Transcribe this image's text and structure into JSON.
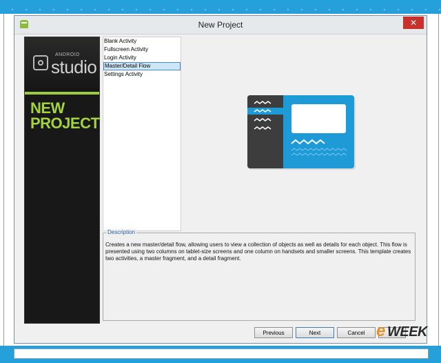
{
  "window": {
    "title": "New Project",
    "close_glyph": "✕"
  },
  "sidebar": {
    "logo_small": "ANDROID",
    "logo_big": "studio",
    "heading_line1": "NEW",
    "heading_line2": "PROJECT"
  },
  "activities": {
    "items": [
      {
        "label": "Blank Activity",
        "selected": false
      },
      {
        "label": "Fullscreen Activity",
        "selected": false
      },
      {
        "label": "Login Activity",
        "selected": false
      },
      {
        "label": "Master/Detail Flow",
        "selected": true
      },
      {
        "label": "Settings Activity",
        "selected": false
      }
    ]
  },
  "description": {
    "legend": "Description",
    "text": "Creates a new master/detail flow, allowing users to view a collection of objects as well as details for each object. This flow is presented using two columns on tablet-size screens and one column on handsets and smaller screens. This template creates two activities, a master fragment, and a detail fragment."
  },
  "buttons": {
    "previous": "Previous",
    "next": "Next",
    "cancel": "Cancel"
  },
  "watermark": {
    "e": "e",
    "week": "WEEK"
  },
  "colors": {
    "taskbar_blue": "#26a0da",
    "sidebar_bg": "#181818",
    "brand_green": "#a4d33d",
    "preview_blue": "#1e9ad6",
    "preview_dark": "#3d3d3d",
    "close_red": "#c7302b"
  }
}
